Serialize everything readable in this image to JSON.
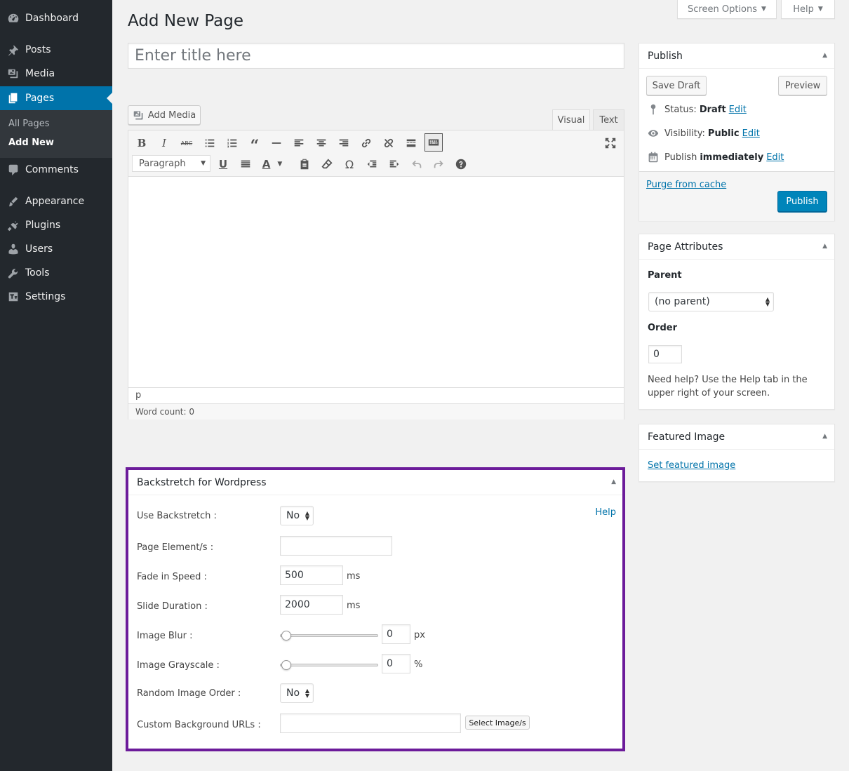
{
  "sidebar": {
    "items": [
      {
        "label": "Dashboard",
        "icon": "dashboard-icon"
      },
      {
        "label": "Posts",
        "icon": "pin-icon"
      },
      {
        "label": "Media",
        "icon": "media-icon"
      },
      {
        "label": "Pages",
        "icon": "pages-icon"
      },
      {
        "label": "Comments",
        "icon": "comments-icon"
      },
      {
        "label": "Appearance",
        "icon": "paintbrush-icon"
      },
      {
        "label": "Plugins",
        "icon": "plugins-icon"
      },
      {
        "label": "Users",
        "icon": "users-icon"
      },
      {
        "label": "Tools",
        "icon": "wrench-icon"
      },
      {
        "label": "Settings",
        "icon": "settings-icon"
      }
    ],
    "submenu": [
      "All Pages",
      "Add New"
    ],
    "active": "Pages",
    "active_color": "#0073aa"
  },
  "header": {
    "title": "Add New Page",
    "screen_options": "Screen Options",
    "help": "Help"
  },
  "editor": {
    "title_placeholder": "Enter title here",
    "add_media": "Add Media",
    "tab_visual": "Visual",
    "tab_text": "Text",
    "format": "Paragraph",
    "path": "p",
    "word_count": "Word count: 0"
  },
  "publish": {
    "title": "Publish",
    "save_draft": "Save Draft",
    "preview": "Preview",
    "status_label": "Status:",
    "status_value": "Draft",
    "visibility_label": "Visibility:",
    "visibility_value": "Public",
    "publish_label": "Publish",
    "publish_value": "immediately",
    "edit": "Edit",
    "purge": "Purge from cache",
    "publish_button": "Publish"
  },
  "page_attributes": {
    "title": "Page Attributes",
    "parent_label": "Parent",
    "parent_value": "(no parent)",
    "order_label": "Order",
    "order_value": "0",
    "help_text": "Need help? Use the Help tab in the upper right of your screen."
  },
  "featured_image": {
    "title": "Featured Image",
    "link": "Set featured image"
  },
  "backstretch": {
    "title": "Backstretch for Wordpress",
    "help": "Help",
    "use_label": "Use Backstretch :",
    "use_value": "No",
    "elements_label": "Page Element/s :",
    "elements_value": "",
    "fade_label": "Fade in Speed :",
    "fade_value": "500",
    "fade_unit": "ms",
    "duration_label": "Slide Duration :",
    "duration_value": "2000",
    "duration_unit": "ms",
    "blur_label": "Image Blur :",
    "blur_value": "0",
    "blur_unit": "px",
    "grayscale_label": "Image Grayscale :",
    "grayscale_value": "0",
    "grayscale_unit": "%",
    "random_label": "Random Image Order :",
    "random_value": "No",
    "urls_label": "Custom Background URLs :",
    "urls_value": "",
    "select_button": "Select Image/s",
    "border_color": "#6c1b9a"
  }
}
